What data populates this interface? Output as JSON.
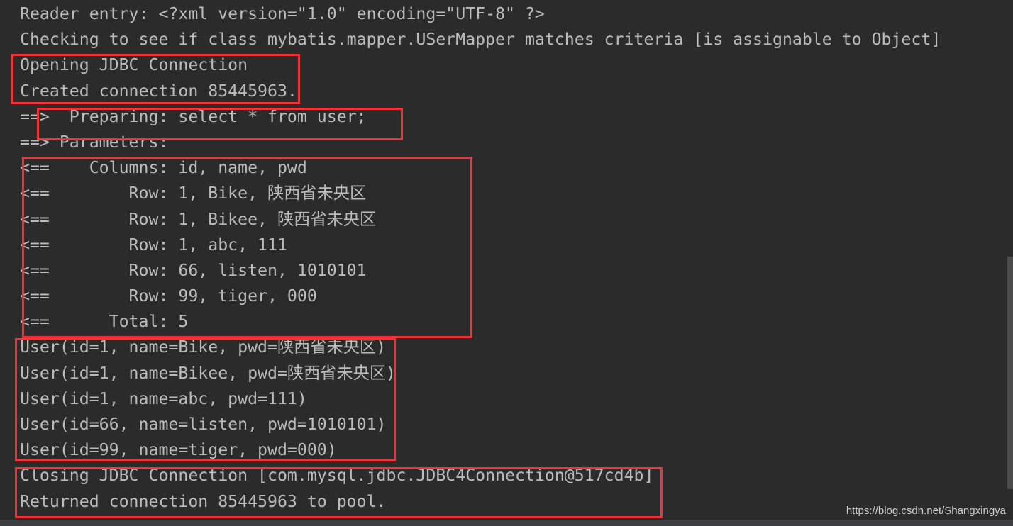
{
  "console": {
    "lines": [
      "Reader entry: <?xml version=\"1.0\" encoding=\"UTF-8\" ?>",
      "Checking to see if class mybatis.mapper.USerMapper matches criteria [is assignable to Object]",
      "Opening JDBC Connection",
      "Created connection 85445963.",
      "==>  Preparing: select * from user;",
      "==> Parameters: ",
      "<==    Columns: id, name, pwd",
      "<==        Row: 1, Bike, 陕西省未央区",
      "<==        Row: 1, Bikee, 陕西省未央区",
      "<==        Row: 1, abc, 111",
      "<==        Row: 66, listen, 1010101",
      "<==        Row: 99, tiger, 000",
      "<==      Total: 5",
      "User(id=1, name=Bike, pwd=陕西省未央区)",
      "User(id=1, name=Bikee, pwd=陕西省未央区)",
      "User(id=1, name=abc, pwd=111)",
      "User(id=66, name=listen, pwd=1010101)",
      "User(id=99, name=tiger, pwd=000)",
      "Closing JDBC Connection [com.mysql.jdbc.JDBC4Connection@517cd4b]",
      "Returned connection 85445963 to pool."
    ]
  },
  "watermark": "https://blog.csdn.net/Shangxingya",
  "colors": {
    "background": "#2b2b2b",
    "text": "#bbbbbb",
    "highlight_box": "#f0343a"
  }
}
